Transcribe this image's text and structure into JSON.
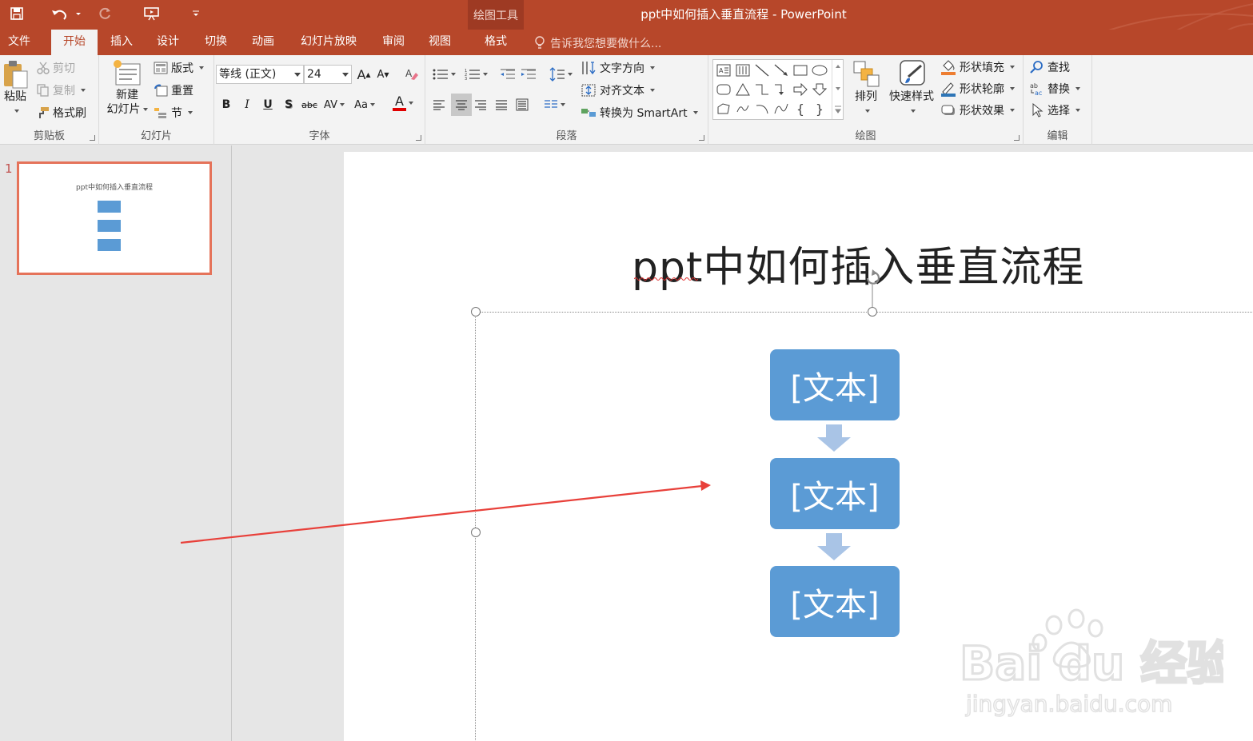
{
  "titlebar": {
    "title": "ppt中如何插入垂直流程 - PowerPoint",
    "context_group": "绘图工具"
  },
  "tabs": {
    "file": "文件",
    "home": "开始",
    "insert": "插入",
    "design": "设计",
    "transitions": "切换",
    "animations": "动画",
    "slideshow": "幻灯片放映",
    "review": "审阅",
    "view": "视图",
    "format": "格式",
    "tell_me": "告诉我您想要做什么..."
  },
  "clipboard": {
    "paste": "粘贴",
    "cut": "剪切",
    "copy": "复制",
    "format_painter": "格式刷",
    "label": "剪贴板"
  },
  "slides_group": {
    "new_slide_line1": "新建",
    "new_slide_line2": "幻灯片",
    "layout": "版式",
    "reset": "重置",
    "section": "节",
    "label": "幻灯片"
  },
  "font": {
    "family": "等线 (正文)",
    "size": "24",
    "label": "字体",
    "bold": "B",
    "italic": "I",
    "underline": "U",
    "shadow": "S",
    "strike": "abc",
    "spacing": "AV",
    "case": "Aa",
    "color_letter": "A",
    "grow": "A",
    "shrink": "A"
  },
  "paragraph": {
    "text_direction": "文字方向",
    "align_text": "对齐文本",
    "smartart": "转换为 SmartArt",
    "label": "段落"
  },
  "drawing": {
    "arrange": "排列",
    "quick_styles": "快速样式",
    "shape_fill": "形状填充",
    "shape_outline": "形状轮廓",
    "shape_effects": "形状效果",
    "label": "绘图"
  },
  "editing": {
    "find": "查找",
    "replace": "替换",
    "select": "选择",
    "label": "编辑"
  },
  "thumbnails": {
    "number": "1",
    "title": "ppt中如何插入垂直流程"
  },
  "slide": {
    "title": "ppt中如何插入垂直流程",
    "boxes": [
      "[文本]",
      "[文本]",
      "[文本]"
    ]
  },
  "watermark": {
    "brand": "Bai du 经验",
    "url": "jingyan.baidu.com"
  },
  "colors": {
    "accent": "#b7472a",
    "smartart_box": "#5b9bd5",
    "smartart_arrow": "#a9c4e6",
    "annotation_arrow": "#e8403a"
  }
}
